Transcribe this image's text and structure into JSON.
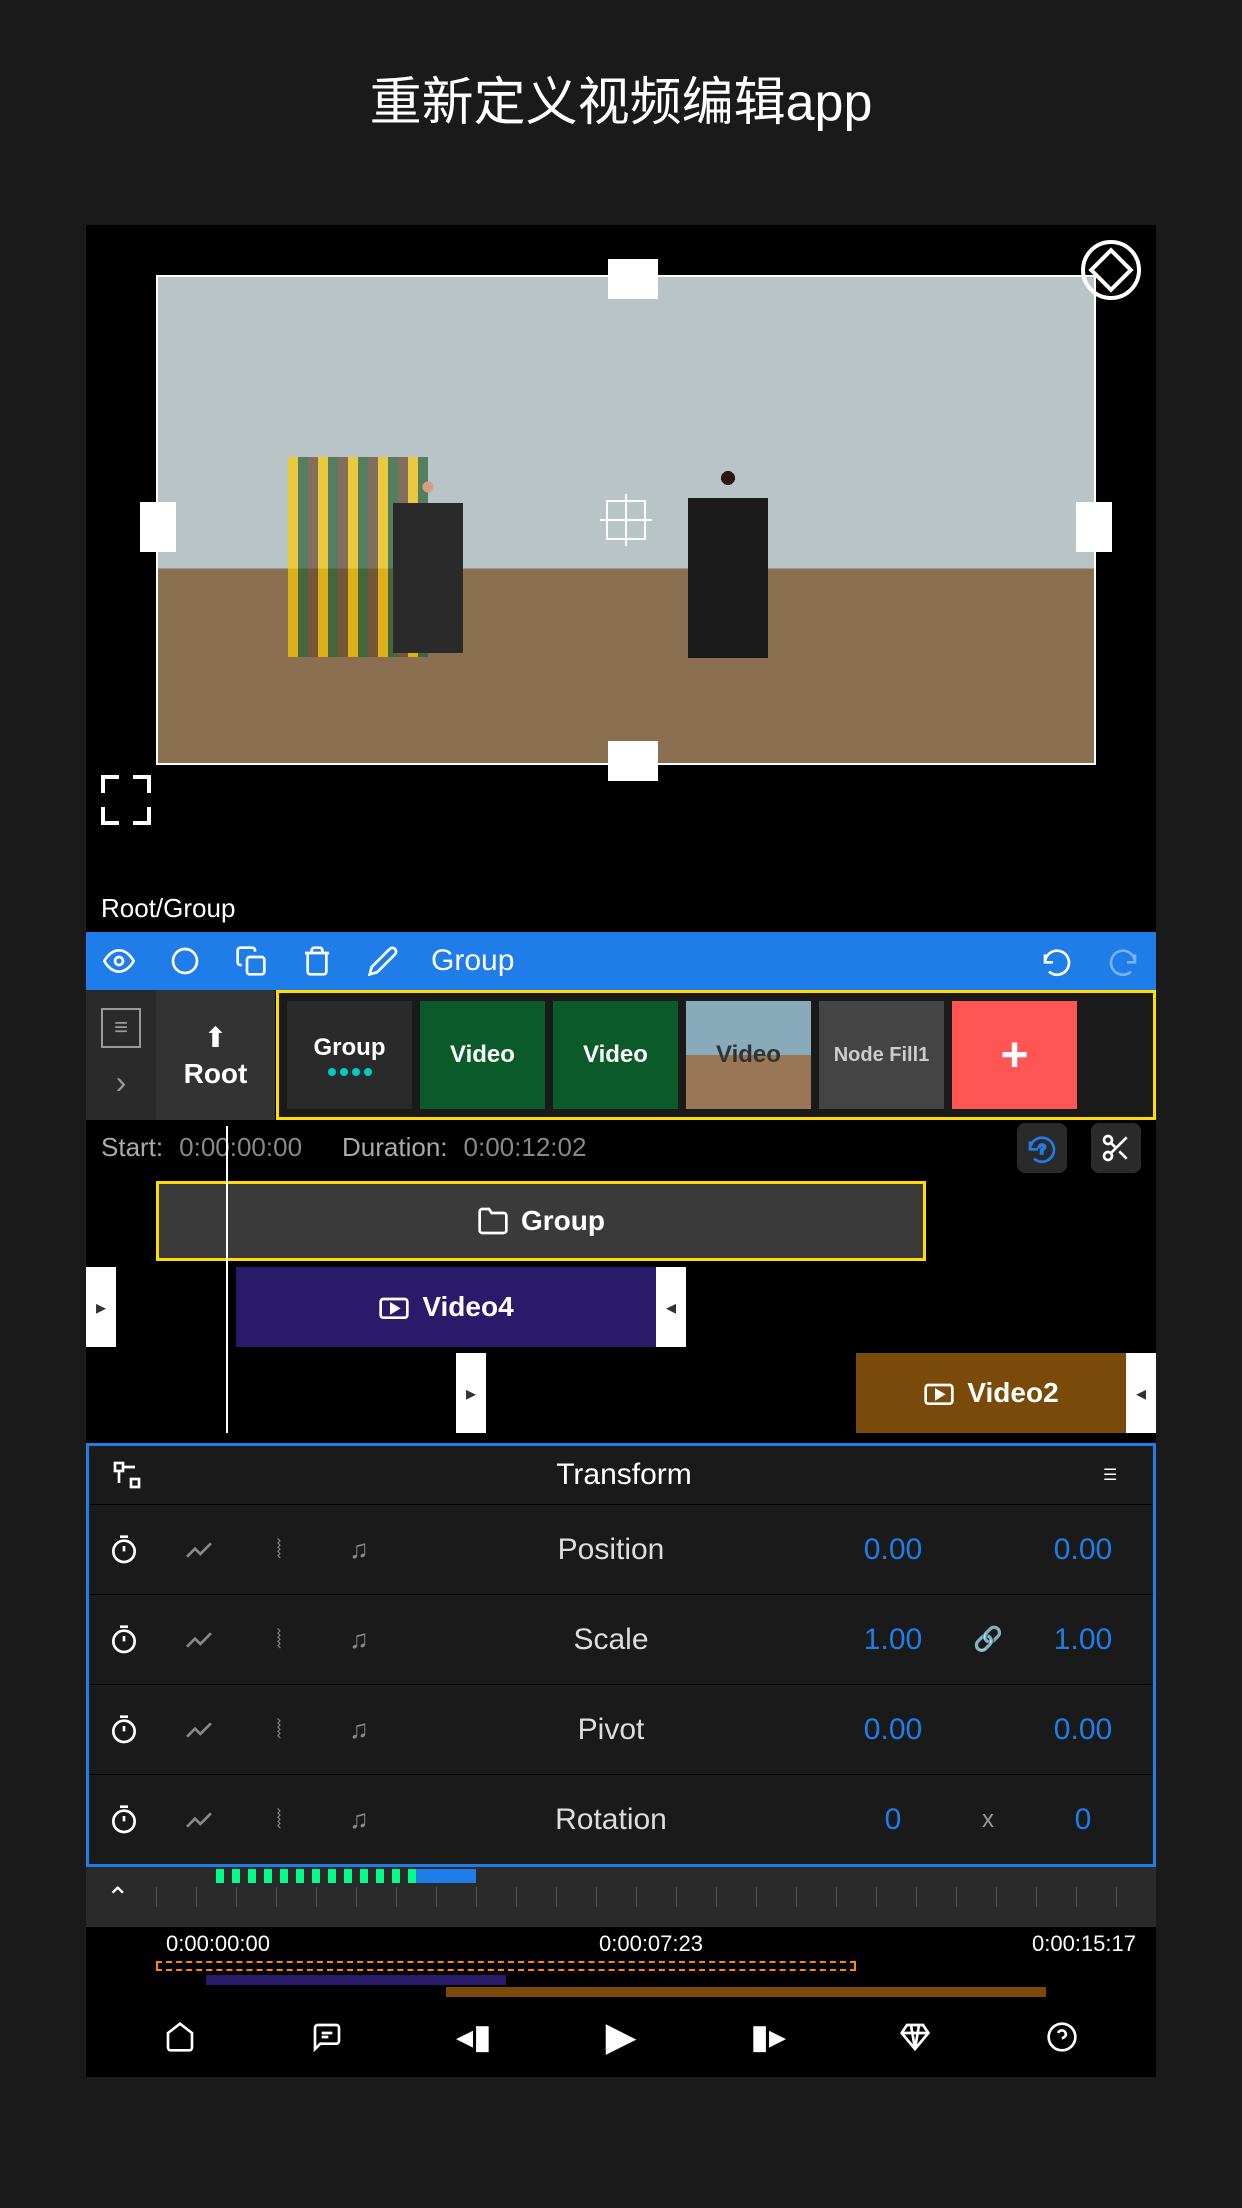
{
  "page_title": "重新定义视频编辑app",
  "breadcrumb": "Root/Group",
  "toolbar": {
    "group_label": "Group"
  },
  "nodes": {
    "root_label": "Root",
    "items": [
      "Group",
      "Video",
      "Video",
      "Video",
      "Node Fill1"
    ],
    "add_label": "+"
  },
  "timing": {
    "start_label": "Start:",
    "start_value": "0:00:00:00",
    "duration_label": "Duration:",
    "duration_value": "0:00:12:02"
  },
  "clips": {
    "group_label": "Group",
    "video4_label": "Video4",
    "video2_label": "Video2"
  },
  "transform": {
    "title": "Transform",
    "rows": [
      {
        "label": "Position",
        "v1": "0.00",
        "v2": "0.00",
        "link": ""
      },
      {
        "label": "Scale",
        "v1": "1.00",
        "v2": "1.00",
        "link": "link"
      },
      {
        "label": "Pivot",
        "v1": "0.00",
        "v2": "0.00",
        "link": ""
      },
      {
        "label": "Rotation",
        "v1": "0",
        "v2": "0",
        "link": "x"
      }
    ]
  },
  "ruler": {
    "t1": "0:00:00:00",
    "t2": "0:00:07:23",
    "t3": "0:00:15:17"
  }
}
